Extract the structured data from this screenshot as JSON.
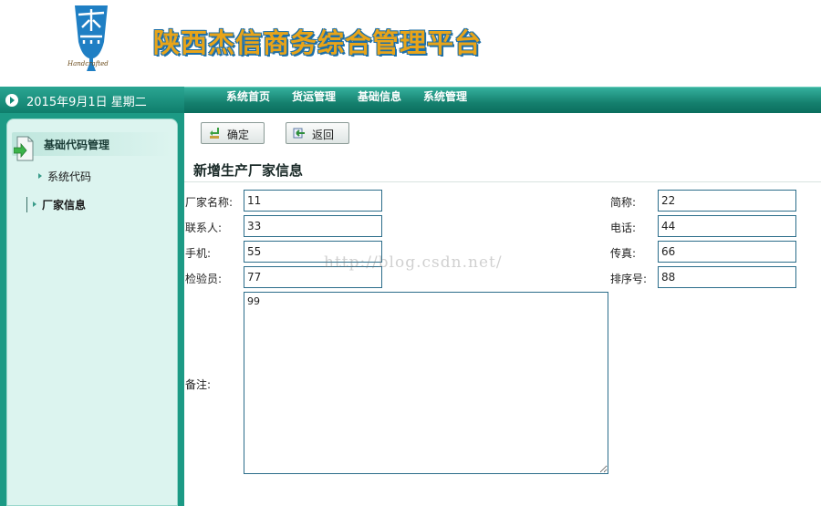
{
  "header": {
    "title": "陕西杰信商务综合管理平台",
    "logo_text": "杰信",
    "logo_sub": "Handcrafted"
  },
  "datebar": {
    "date": "2015年9月1日 星期二"
  },
  "nav": [
    "系统首页",
    "货运管理",
    "基础信息",
    "系统管理"
  ],
  "sidebar": {
    "section": "基础代码管理",
    "items": [
      {
        "label": "系统代码",
        "active": false
      },
      {
        "label": "厂家信息",
        "active": true
      }
    ]
  },
  "toolbar": {
    "confirm_label": "确定",
    "back_label": "返回"
  },
  "form": {
    "title": "新增生产厂家信息",
    "fields": {
      "factory_name": {
        "label": "厂家名称:",
        "value": "11"
      },
      "short_name": {
        "label": "简称:",
        "value": "22"
      },
      "contact": {
        "label": "联系人:",
        "value": "33"
      },
      "phone": {
        "label": "电话:",
        "value": "44"
      },
      "mobile": {
        "label": "手机:",
        "value": "55"
      },
      "fax": {
        "label": "传真:",
        "value": "66"
      },
      "inspector": {
        "label": "检验员:",
        "value": "77"
      },
      "order_no": {
        "label": "排序号:",
        "value": "88"
      },
      "remark": {
        "label": "备注:",
        "value": "99"
      }
    }
  },
  "watermark": "http://blog.csdn.net/",
  "colors": {
    "nav_teal": "#15806e",
    "sidebar_bg": "#dcf4ef",
    "title_orange": "#e8a419",
    "input_border": "#2b6d8a"
  }
}
